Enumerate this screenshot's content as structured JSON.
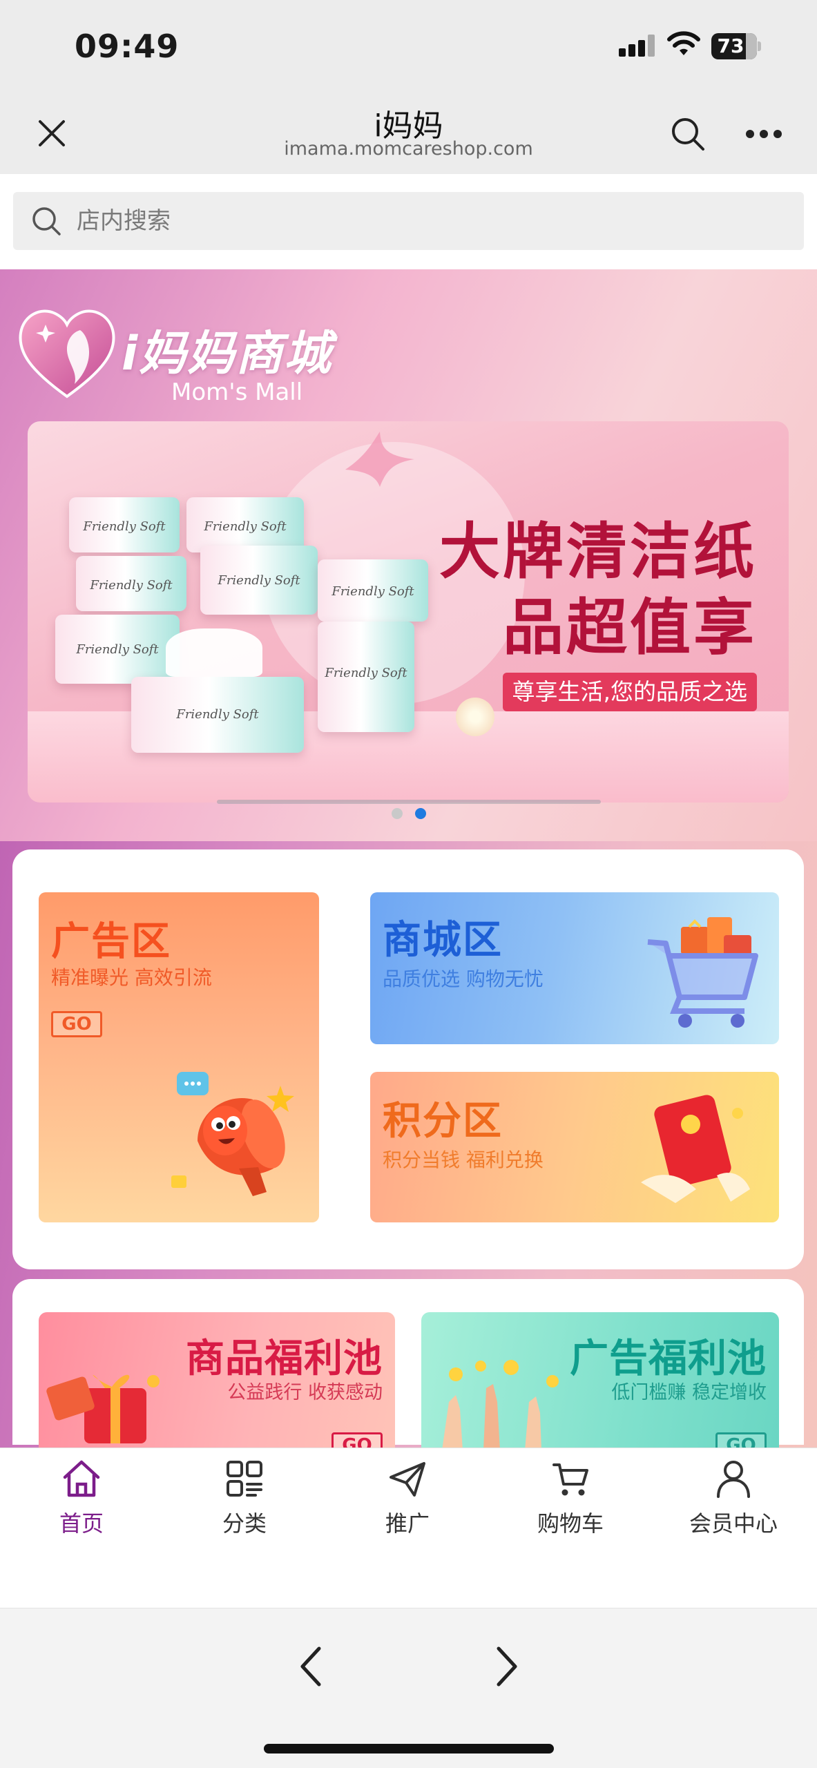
{
  "status": {
    "time": "09:49",
    "battery": "73",
    "battery_level": 73
  },
  "nav": {
    "title": "i妈妈",
    "subtitle": "imama.momcareshop.com",
    "icons": [
      "close-icon",
      "search-icon",
      "more-icon"
    ]
  },
  "search": {
    "placeholder": "店内搜索"
  },
  "banner": {
    "brand_name": "i妈妈商城",
    "brand_sub": "Mom's Mall",
    "headline_1": "大牌清洁纸",
    "headline_2": "品超值享",
    "tagline": "尊享生活,您的品质之选",
    "product_label": "Friendly Soft",
    "slides": 2,
    "active_slide": 2
  },
  "zones": {
    "ad": {
      "title": "广告区",
      "subtitle": "精准曝光 高效引流",
      "go": "GO"
    },
    "mall": {
      "title": "商城区",
      "subtitle": "品质优选 购物无忧"
    },
    "points": {
      "title": "积分区",
      "subtitle": "积分当钱 福利兑换"
    }
  },
  "welfare": {
    "goods": {
      "title": "商品福利池",
      "subtitle": "公益践行 收获感动",
      "go": "GO"
    },
    "ads": {
      "title": "广告福利池",
      "subtitle": "低门槛赚 稳定增收",
      "go": "GO"
    }
  },
  "tabbar": {
    "items": [
      {
        "label": "首页",
        "icon": "home-icon",
        "active": true
      },
      {
        "label": "分类",
        "icon": "category-icon",
        "active": false
      },
      {
        "label": "推广",
        "icon": "send-icon",
        "active": false
      },
      {
        "label": "购物车",
        "icon": "cart-icon",
        "active": false
      },
      {
        "label": "会员中心",
        "icon": "user-icon",
        "active": false
      }
    ]
  },
  "colors": {
    "accent": "#7c1d8a",
    "promo_red": "#b2123a",
    "slide_dot_active": "#1f7be0"
  }
}
